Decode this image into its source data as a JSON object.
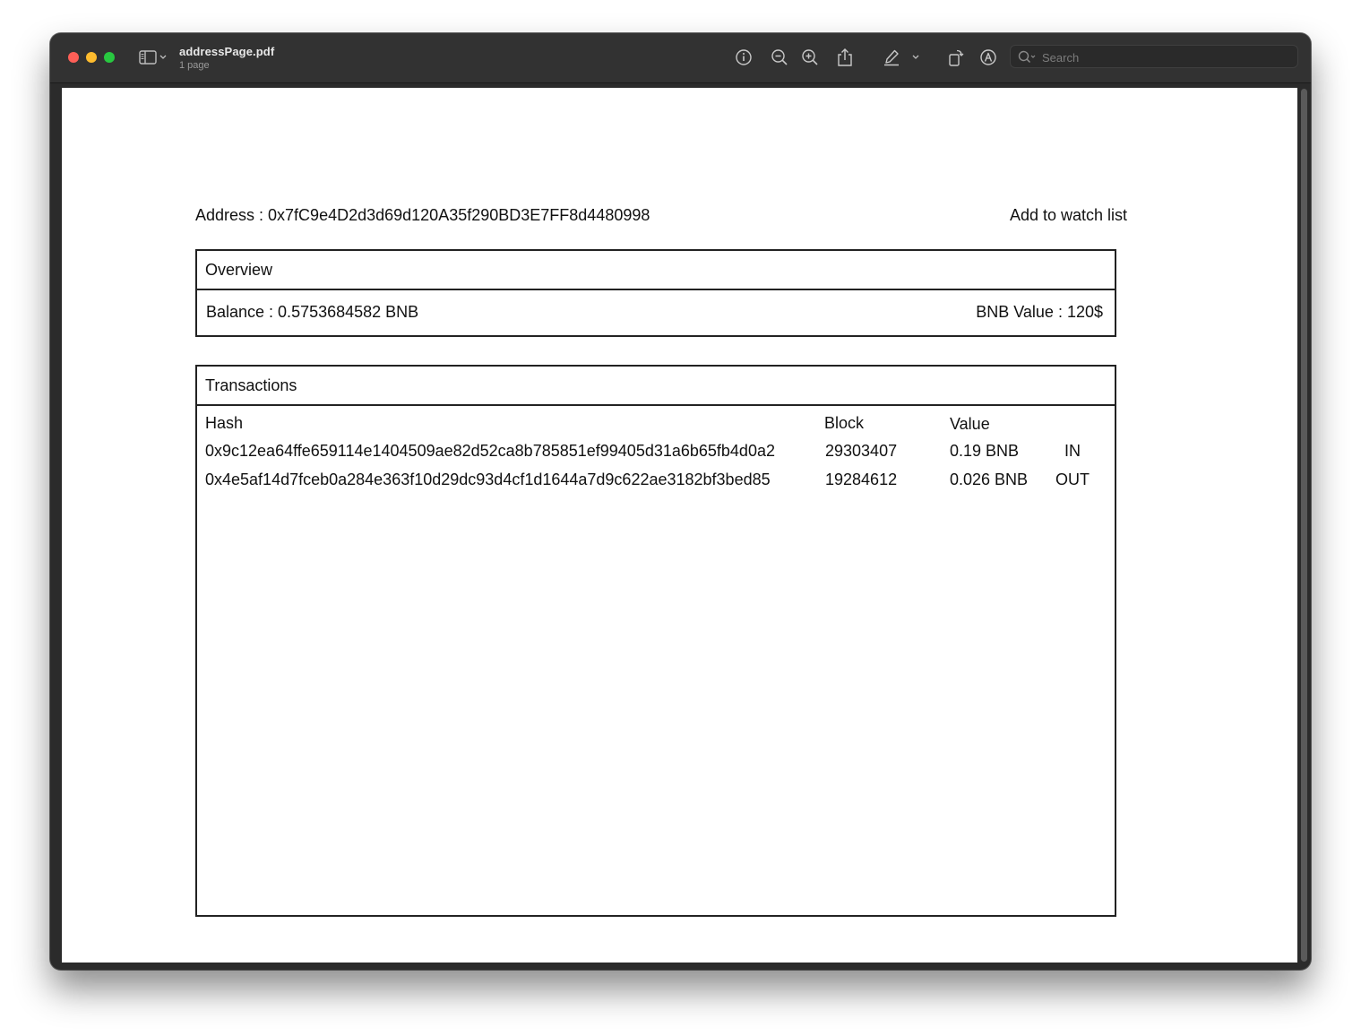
{
  "window": {
    "title": "addressPage.pdf",
    "subtitle": "1 page"
  },
  "toolbar": {
    "search_placeholder": "Search",
    "icons": [
      "sidebar-icon",
      "chevron-down-icon",
      "info-icon",
      "zoom-out-icon",
      "zoom-in-icon",
      "share-icon",
      "highlight-pen-icon",
      "chevron-down-icon",
      "rotate-icon",
      "markup-icon",
      "search-icon"
    ]
  },
  "document": {
    "address_text": "Address : 0x7fC9e4D2d3d69d120A35f290BD3E7FF8d4480998",
    "watch_link": "Add to watch list",
    "overview": {
      "header": "Overview",
      "balance": "Balance : 0.5753684582 BNB",
      "bnb_value": "BNB Value : 120$"
    },
    "transactions": {
      "header": "Transactions",
      "columns": {
        "hash": "Hash",
        "block": "Block",
        "value": "Value"
      },
      "rows": [
        {
          "hash": "0x9c12ea64ffe659114e1404509ae82d52ca8b785851ef99405d31a6b65fb4d0a2",
          "block": "29303407",
          "value": "0.19 BNB",
          "direction": "IN"
        },
        {
          "hash": "0x4e5af14d7fceb0a284e363f10d29dc93d4cf1d1644a7d9c622ae3182bf3bed85",
          "block": "19284612",
          "value": "0.026 BNB",
          "direction": "OUT"
        }
      ]
    }
  },
  "colors": {
    "titlebar": "#323232",
    "close": "#fe5f57",
    "minimize": "#febc2e",
    "maximize": "#28c840",
    "page": "#ffffff",
    "border": "#222222"
  }
}
